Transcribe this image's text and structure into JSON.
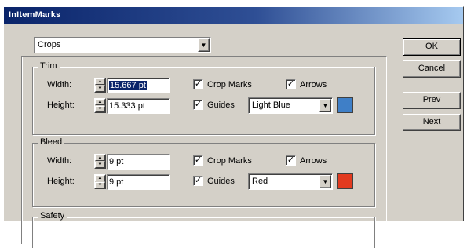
{
  "window": {
    "title": "InItemMarks"
  },
  "mode_select": {
    "value": "Crops"
  },
  "buttons": {
    "ok": "OK",
    "cancel": "Cancel",
    "prev": "Prev",
    "next": "Next"
  },
  "trim": {
    "title": "Trim",
    "width_label": "Width:",
    "width_value": "15.667 pt",
    "height_label": "Height:",
    "height_value": "15.333 pt",
    "crop_marks_label": "Crop Marks",
    "crop_marks_checked": true,
    "arrows_label": "Arrows",
    "arrows_checked": true,
    "guides_label": "Guides",
    "guides_checked": true,
    "color_value": "Light Blue",
    "swatch_color": "#3f7fc7"
  },
  "bleed": {
    "title": "Bleed",
    "width_label": "Width:",
    "width_value": "9 pt",
    "height_label": "Height:",
    "height_value": "9 pt",
    "crop_marks_label": "Crop Marks",
    "crop_marks_checked": true,
    "arrows_label": "Arrows",
    "arrows_checked": true,
    "guides_label": "Guides",
    "guides_checked": true,
    "color_value": "Red",
    "swatch_color": "#e23a1f"
  },
  "safety": {
    "title": "Safety"
  }
}
